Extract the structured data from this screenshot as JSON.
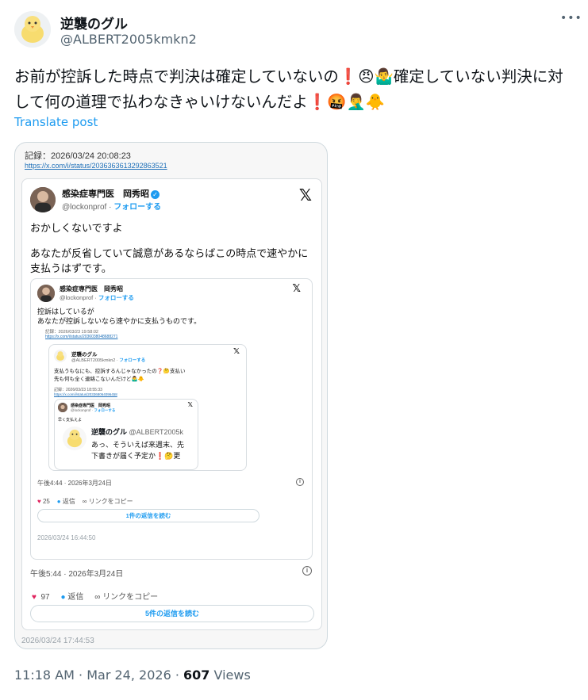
{
  "post": {
    "display_name": "逆襲のグル",
    "handle": "@ALBERT2005kmkn2",
    "more_icon": "more-dots-icon",
    "text": "お前が控訴した時点で判決は確定していないの❗😠🤷‍♂️確定していない判決に対して何の道理で払わなきゃいけないんだよ❗🤬🤦‍♂️🐥",
    "translate_label": "Translate post",
    "time": "11:18 AM",
    "date": "Mar 24, 2026",
    "views_count": "607",
    "views_label": "Views"
  },
  "screenshot": {
    "record_label": "記録：2026/03/24 20:08:23",
    "record_link": "https://x.com/i/status/2036363613292863521",
    "outer_card": {
      "name": "感染症専門医　岡秀昭",
      "handle": "@lockonprof",
      "follow": "フォローする",
      "line1": "おかしくないですよ",
      "line2": "あなたが反省していて誠意があるならばこの時点で速やかに支払うはずです。",
      "time": "午後5:44 · 2026年3月24日",
      "likes": "97",
      "reply_label": "返信",
      "copy_link": "リンクをコピー",
      "read_replies": "5件の返信を読む",
      "stamp": "2026/03/24 17:44:53"
    },
    "card2": {
      "name": "感染症専門医　岡秀昭",
      "handle": "@lockonprof",
      "follow": "フォローする",
      "line1": "控訴はしているが",
      "line2": "あなたが控訴しないなら速やかに支払うものです。",
      "rec_label": "記録：2026/03/23 19:58:02",
      "rec_link": "https://x.com/i/status/2036038048688271",
      "time": "午後4:44 · 2026年3月24日",
      "likes": "25",
      "reply_label": "返信",
      "copy_link": "リンクをコピー",
      "read_replies": "1件の返信を読む",
      "stamp": "2026/03/24 16:44:50"
    },
    "card3": {
      "name": "逆襲のグル",
      "handle": "@ALBERT2005kmkn2",
      "follow": "フォローする",
      "line1": "支払うもなにも、控訴するんじゃなかったの❓🤔支払い",
      "line2": "先も何も全く連絡こないんだけど🤷‍♂️🐥",
      "rec_label": "記録：2026/03/23 18:55:33",
      "rec_link": "https://x.com/i/status/203368064096458"
    },
    "card4": {
      "name": "感染症専門医　岡秀昭",
      "handle": "@lockonprof",
      "follow": "フォローする",
      "line1": "早く支払えよ"
    },
    "card5": {
      "name": "逆襲のグル",
      "handle": "@ALBERT2005k",
      "line1": "あっ、そういえば来週末、先",
      "line2": "下書きが届く予定か❗🤔更"
    }
  }
}
